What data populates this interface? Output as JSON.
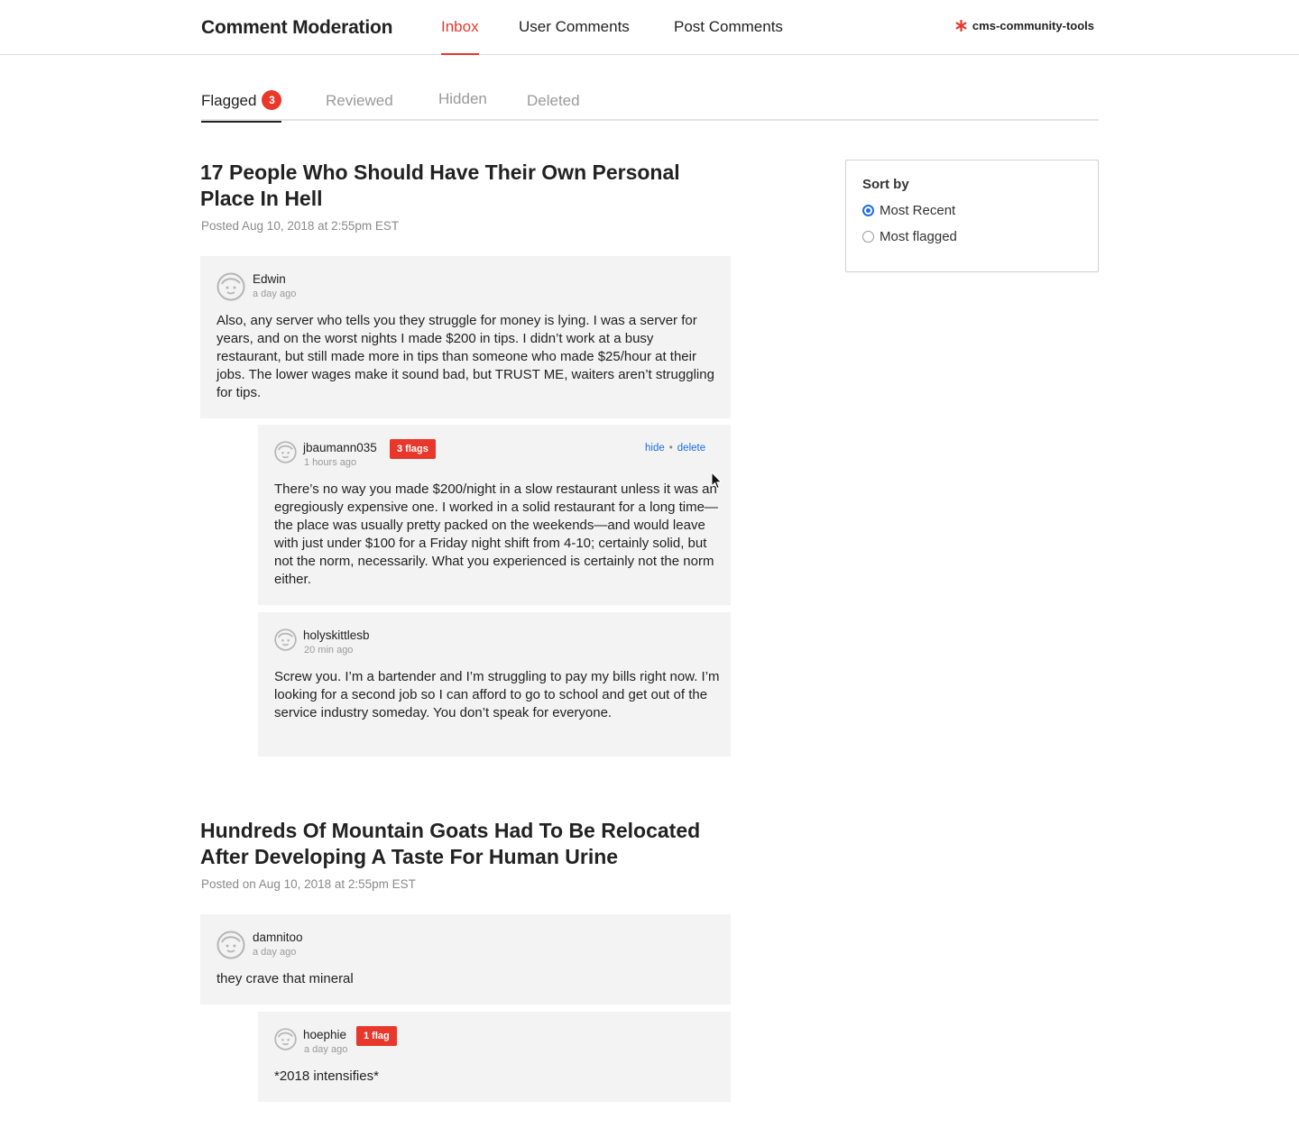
{
  "header": {
    "title": "Comment Moderation",
    "nav": [
      "Inbox",
      "User Comments",
      "Post Comments"
    ],
    "active_nav": "Inbox",
    "brand": "cms-community-tools"
  },
  "subtabs": {
    "items": [
      "Flagged",
      "Reviewed",
      "Hidden",
      "Deleted"
    ],
    "active": "Flagged",
    "flagged_count": "3"
  },
  "sort": {
    "title": "Sort by",
    "options": [
      "Most Recent",
      "Most flagged"
    ],
    "selected": "Most Recent"
  },
  "posts": [
    {
      "title": "17 People Who Should Have Their Own Personal Place In Hell",
      "meta": "Posted Aug 10, 2018 at 2:55pm EST",
      "comment": {
        "user": "Edwin",
        "ago": "a day ago",
        "body": "Also, any server who tells you they struggle for money is lying. I was a server for years, and on the worst nights I made $200 in tips. I didn’t work at a busy restaurant, but still made more in tips than someone who made $25/hour at their jobs. The lower wages make it sound bad, but TRUST ME, waiters aren’t struggling for tips."
      },
      "replies": [
        {
          "user": "jbaumann035",
          "ago": "1 hours ago",
          "flags": "3 flags",
          "hide": "hide",
          "delete": "delete",
          "body": "There’s no way you made $200/night in a slow restaurant unless it was an egregiously expensive one. I worked in a solid restaurant for a long time—the place was usually pretty packed on the weekends—and would leave with just under $100 for a Friday night shift from 4-10; certainly solid, but not the norm, necessarily. What you experienced is certainly not the norm either."
        },
        {
          "user": "holyskittlesb",
          "ago": "20 min ago",
          "body": "Screw you. I’m a bartender and I’m struggling to pay my bills right now. I’m looking for a second job so I can afford to go to school and get out of the service industry someday. You don’t speak for everyone."
        }
      ]
    },
    {
      "title": "Hundreds Of Mountain Goats Had To Be Relocated After Developing A Taste For Human Urine",
      "meta": "Posted on Aug 10, 2018 at 2:55pm EST",
      "comment": {
        "user": "damnitoo",
        "ago": "a day ago",
        "body": "they crave that mineral"
      },
      "replies": [
        {
          "user": "hoephie",
          "ago": "a day ago",
          "flags": "1 flag",
          "body": "*2018 intensifies*"
        }
      ]
    }
  ],
  "colors": {
    "accent": "#e8382c",
    "link": "#1f6fe0",
    "card": "#f3f3f3"
  }
}
